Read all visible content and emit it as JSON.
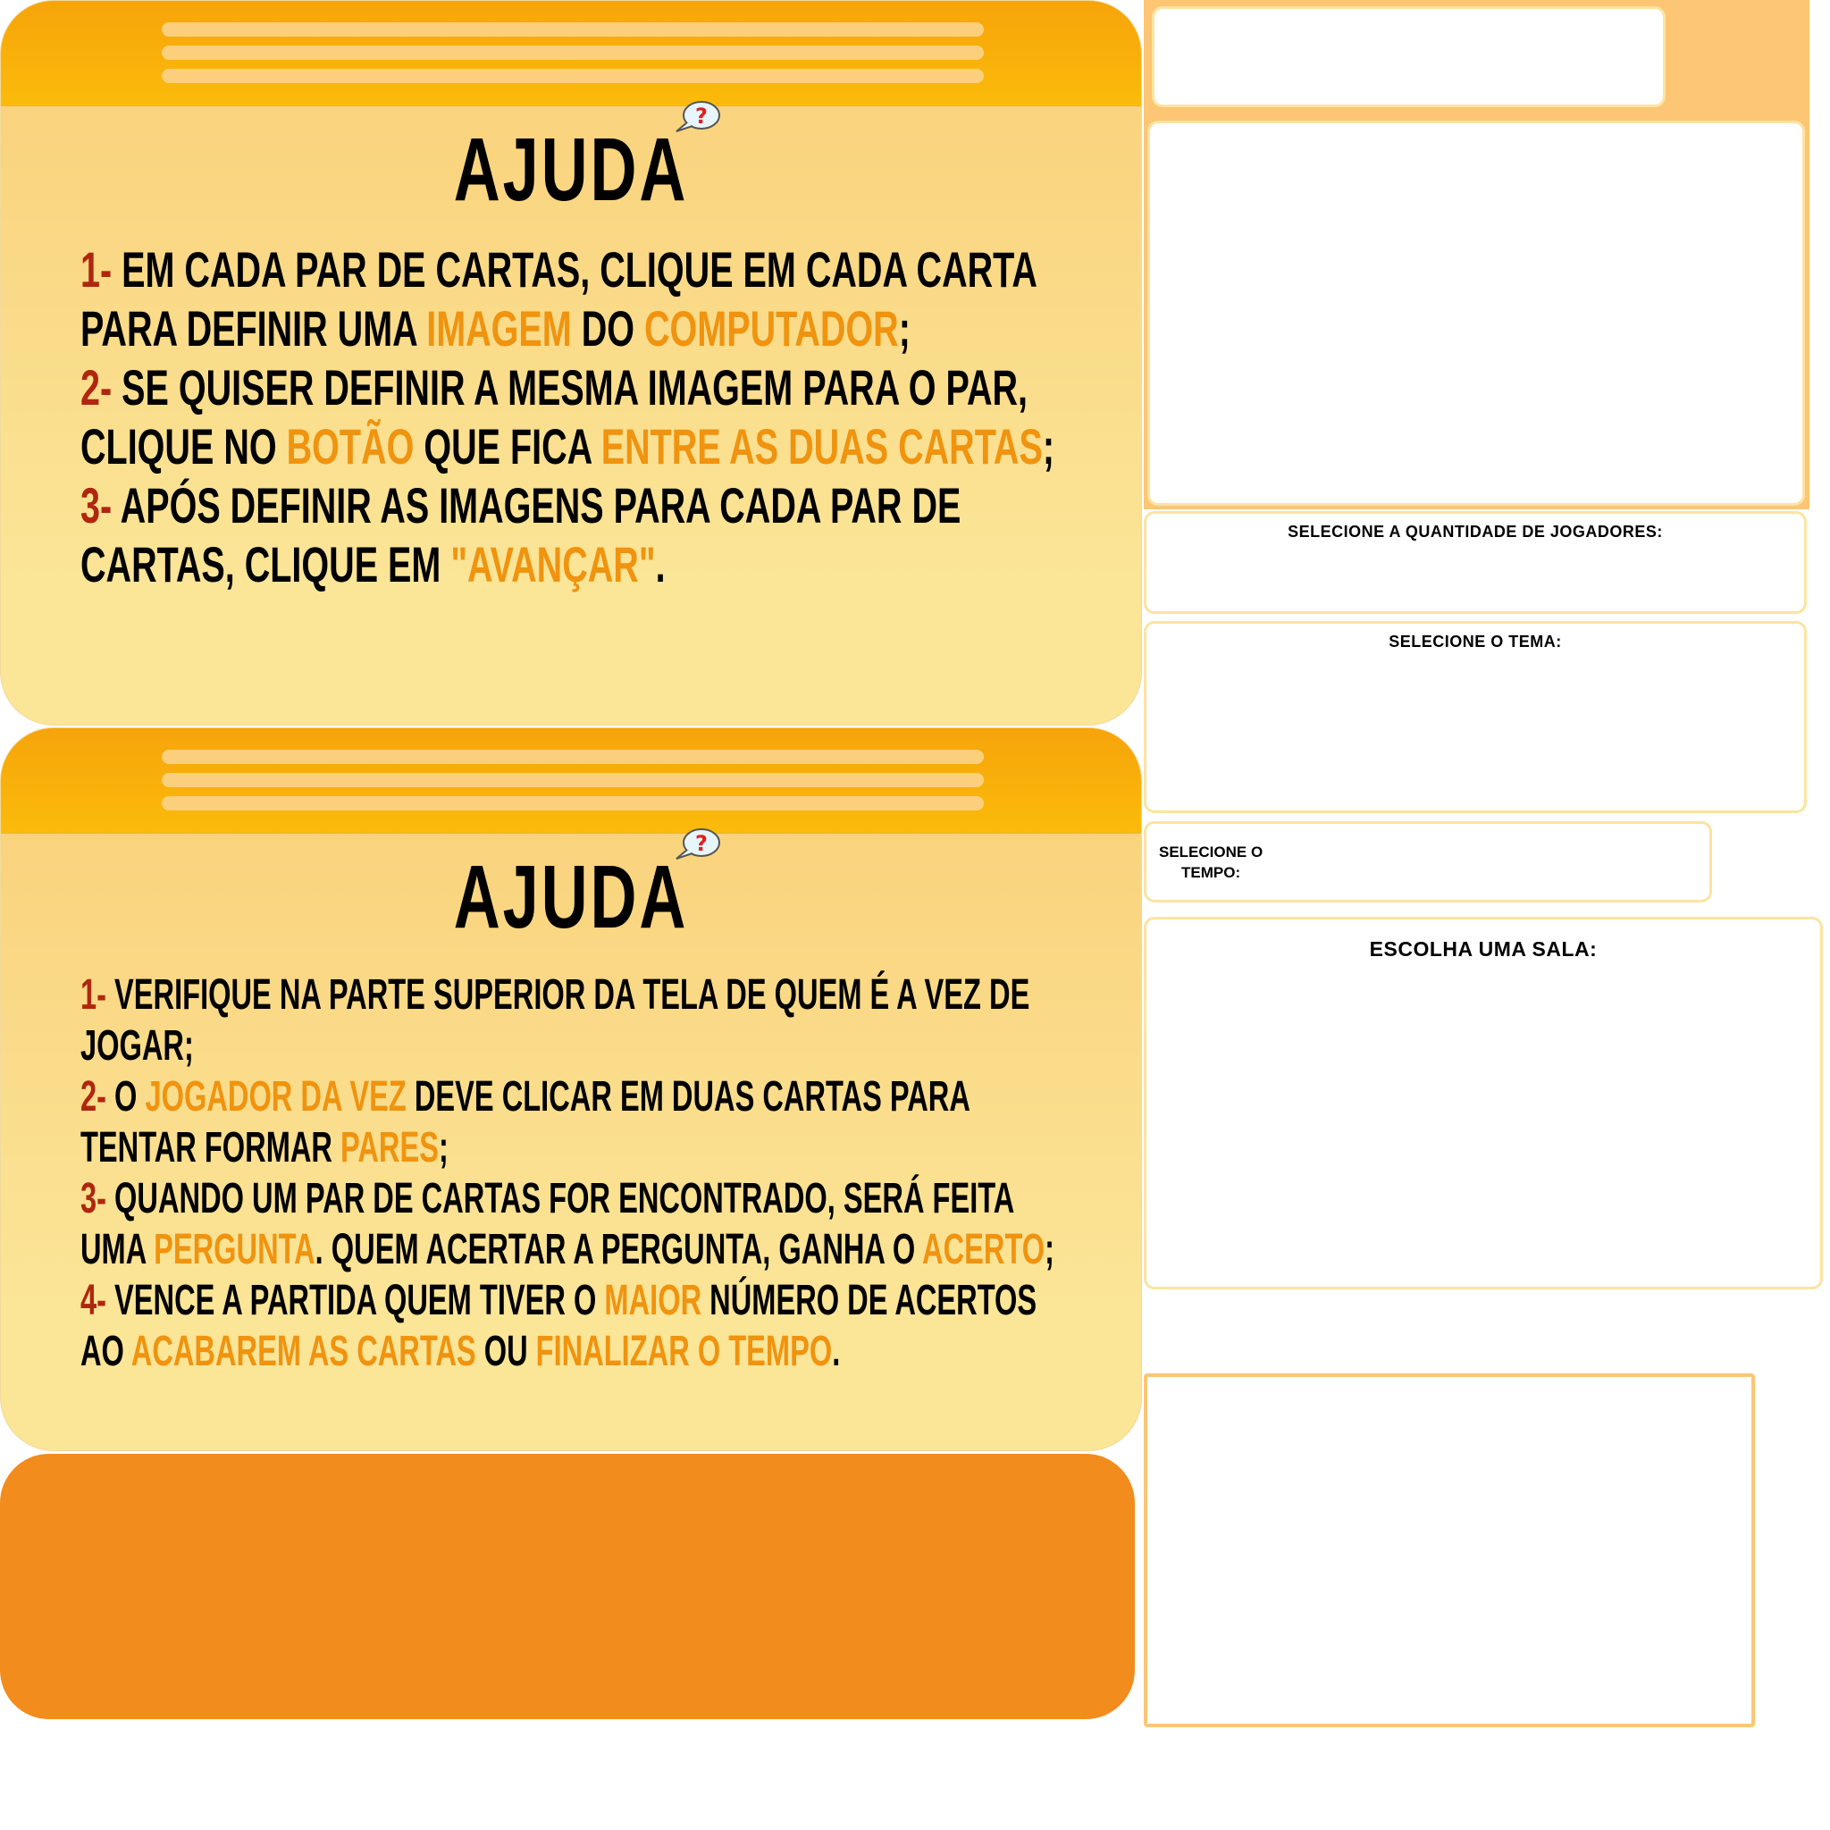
{
  "colors": {
    "number": "#b0260f",
    "highlight": "#f0930f",
    "header": "#f6a40a",
    "panel": "#fcc674",
    "block": "#f28c1c"
  },
  "help_cards": [
    {
      "title": "AJUDA",
      "icon": "help-question-bubble-icon",
      "lines": [
        [
          {
            "t": "1- ",
            "s": "num"
          },
          {
            "t": "EM CADA PAR DE CARTAS, CLIQUE EM CADA CARTA"
          }
        ],
        [
          {
            "t": "PARA DEFINIR UMA "
          },
          {
            "t": "IMAGEM",
            "s": "hl"
          },
          {
            "t": " DO "
          },
          {
            "t": "COMPUTADOR",
            "s": "hl"
          },
          {
            "t": ";"
          }
        ],
        [
          {
            "t": "2- ",
            "s": "num"
          },
          {
            "t": "SE QUISER DEFINIR A MESMA IMAGEM PARA O PAR,"
          }
        ],
        [
          {
            "t": "CLIQUE NO "
          },
          {
            "t": "BOTÃO",
            "s": "hl"
          },
          {
            "t": " QUE FICA "
          },
          {
            "t": "ENTRE AS DUAS CARTAS",
            "s": "hl"
          },
          {
            "t": ";"
          }
        ],
        [
          {
            "t": "3- ",
            "s": "num"
          },
          {
            "t": "APÓS DEFINIR AS IMAGENS PARA CADA PAR DE"
          }
        ],
        [
          {
            "t": "CARTAS, CLIQUE EM "
          },
          {
            "t": "\"AVANÇAR\"",
            "s": "hl"
          },
          {
            "t": "."
          }
        ]
      ]
    },
    {
      "title": "AJUDA",
      "icon": "help-question-bubble-icon",
      "lines": [
        [
          {
            "t": "1- ",
            "s": "num"
          },
          {
            "t": "VERIFIQUE NA PARTE SUPERIOR DA TELA DE QUEM É A VEZ DE"
          }
        ],
        [
          {
            "t": "JOGAR;"
          }
        ],
        [
          {
            "t": "2- ",
            "s": "num"
          },
          {
            "t": "O "
          },
          {
            "t": "JOGADOR DA VEZ",
            "s": "hl"
          },
          {
            "t": " DEVE CLICAR EM DUAS CARTAS PARA"
          }
        ],
        [
          {
            "t": "TENTAR FORMAR "
          },
          {
            "t": "PARES",
            "s": "hl"
          },
          {
            "t": ";"
          }
        ],
        [
          {
            "t": "3- ",
            "s": "num"
          },
          {
            "t": "QUANDO UM PAR DE CARTAS FOR ENCONTRADO, SERÁ FEITA"
          }
        ],
        [
          {
            "t": "UMA "
          },
          {
            "t": "PERGUNTA",
            "s": "hl"
          },
          {
            "t": ". QUEM ACERTAR A PERGUNTA, GANHA O "
          },
          {
            "t": "ACERTO",
            "s": "hl"
          },
          {
            "t": ";"
          }
        ],
        [
          {
            "t": "4- ",
            "s": "num"
          },
          {
            "t": "VENCE A PARTIDA QUEM TIVER O "
          },
          {
            "t": "MAIOR",
            "s": "hl"
          },
          {
            "t": " NÚMERO DE ACERTOS"
          }
        ],
        [
          {
            "t": "AO "
          },
          {
            "t": "ACABAREM AS CARTAS",
            "s": "hl"
          },
          {
            "t": " OU "
          },
          {
            "t": "FINALIZAR O TEMPO",
            "s": "hl"
          },
          {
            "t": "."
          }
        ]
      ]
    }
  ],
  "settings": {
    "players_label": "SELECIONE A QUANTIDADE DE JOGADORES:",
    "theme_label": "SELECIONE O TEMA:",
    "time_label_1": "SELECIONE O",
    "time_label_2": "TEMPO:",
    "room_label": "ESCOLHA UMA SALA:"
  }
}
